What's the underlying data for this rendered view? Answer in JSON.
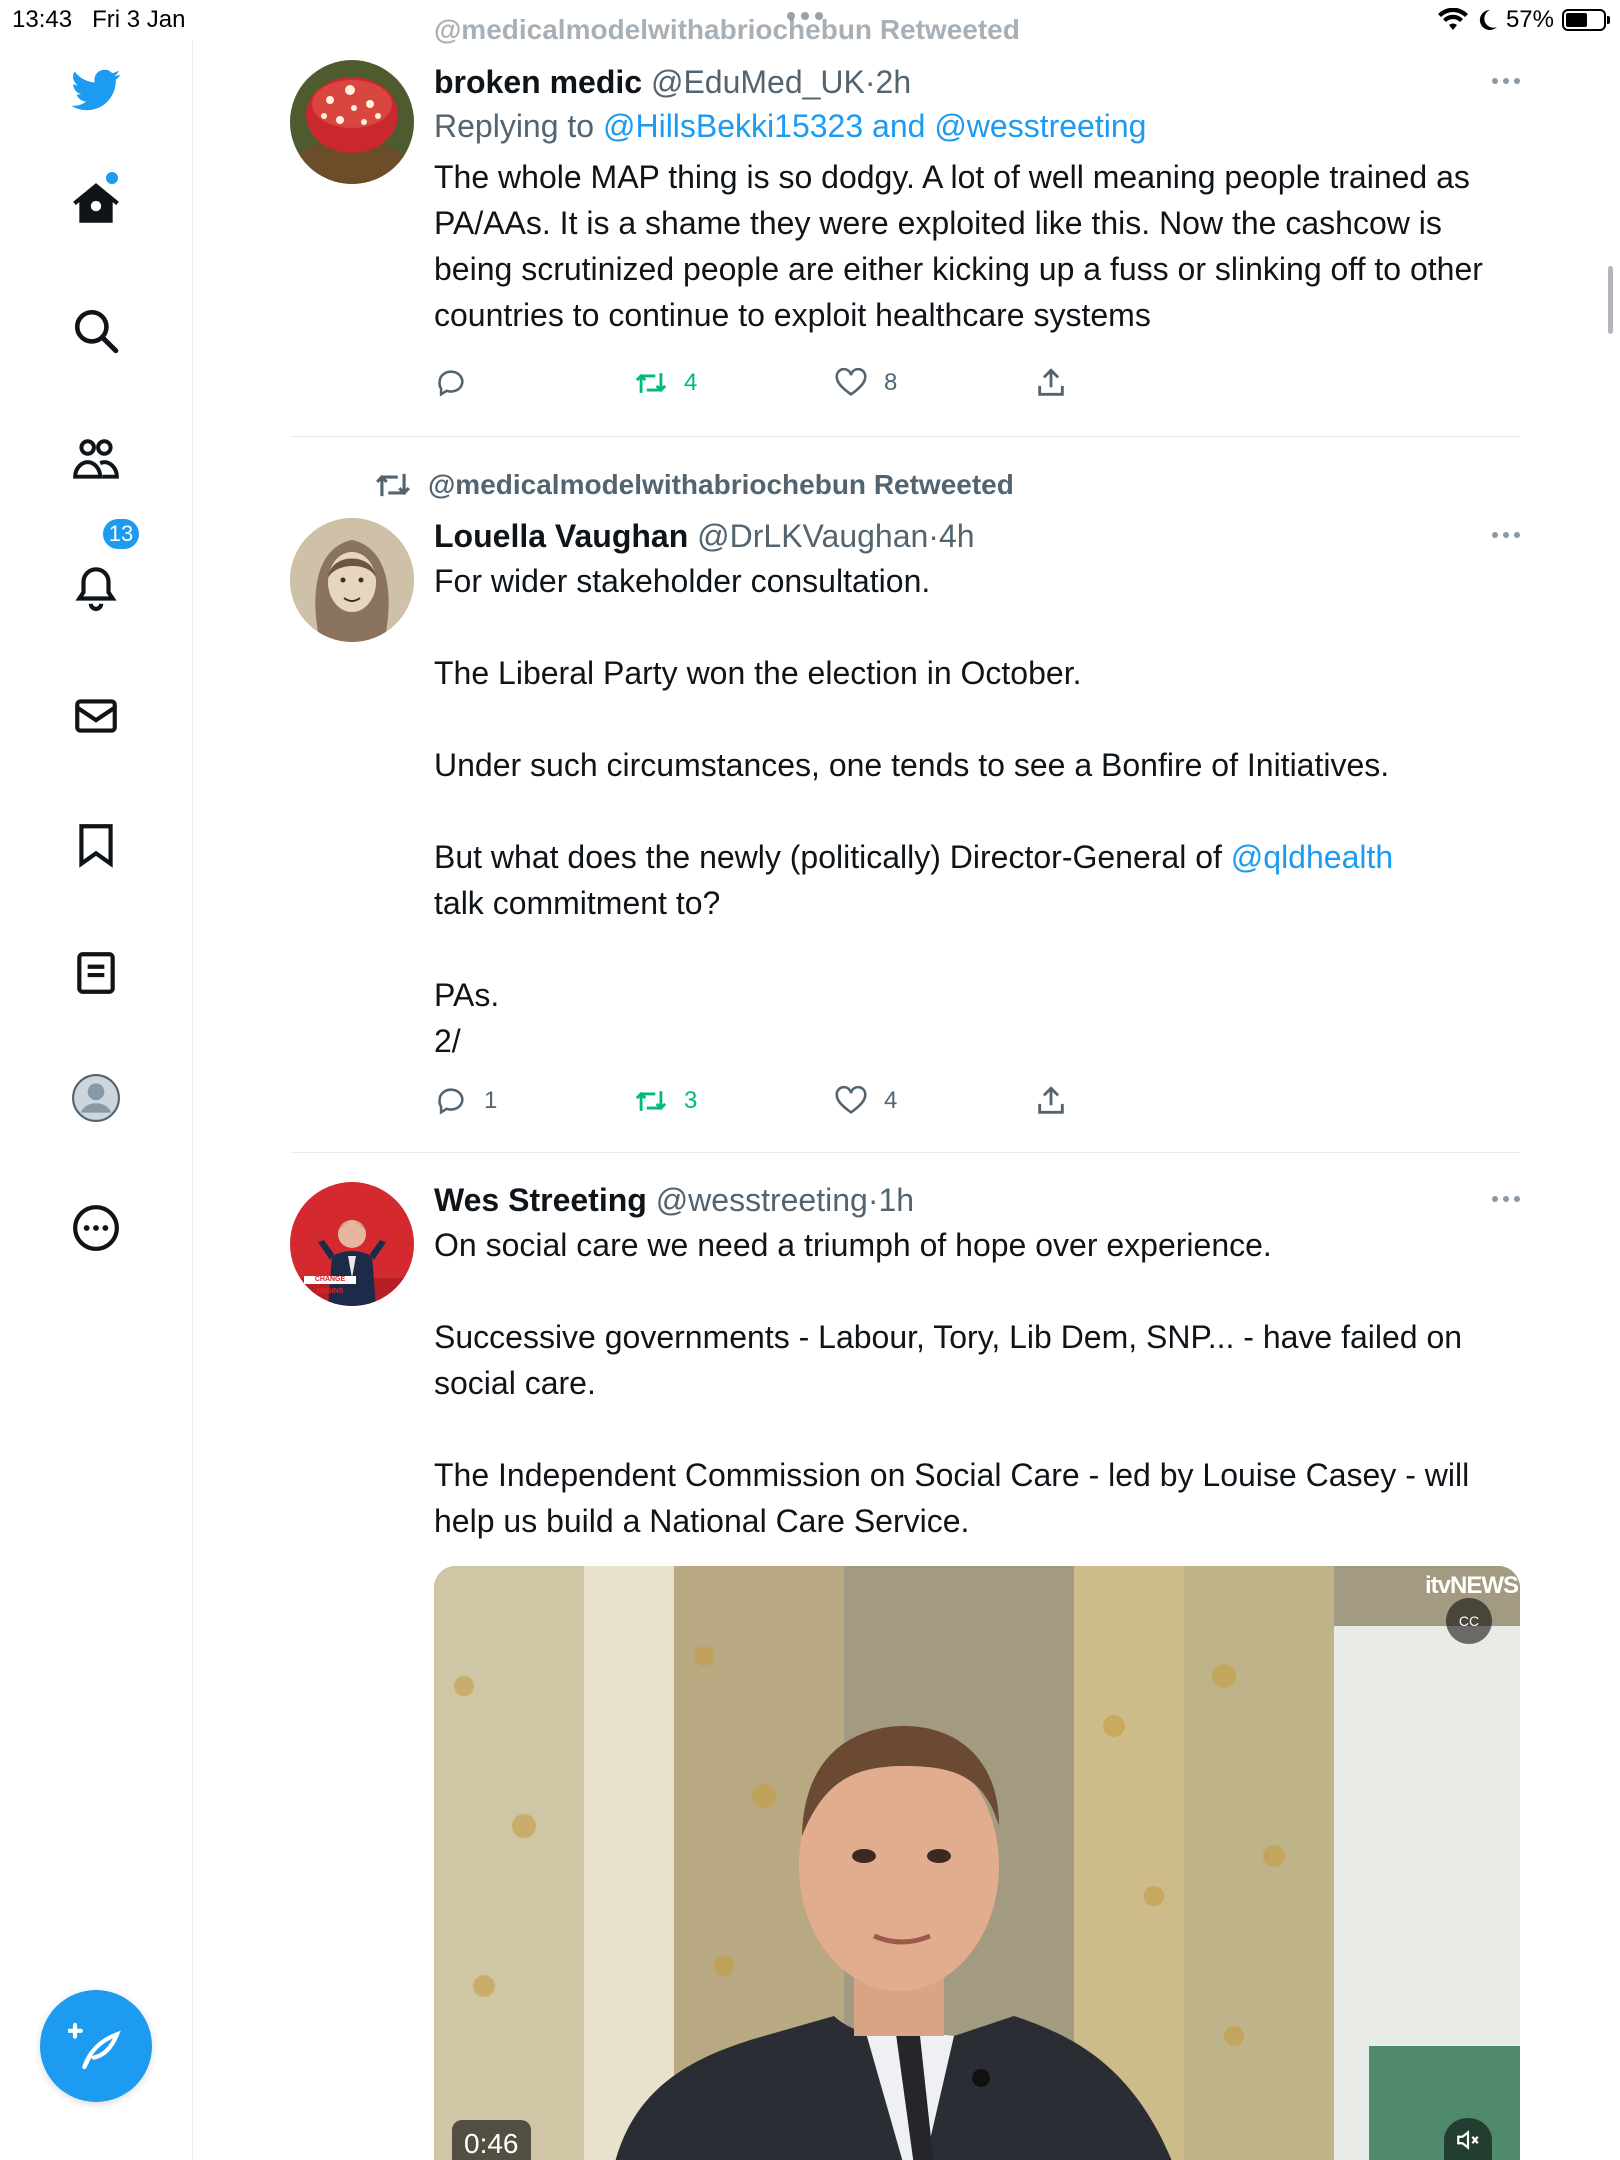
{
  "status_bar": {
    "time": "13:43",
    "date": "Fri 3 Jan",
    "battery": "57%"
  },
  "sidebar": {
    "notifications_count": "13",
    "items": [
      "twitter-logo",
      "home",
      "search",
      "communities",
      "notifications",
      "messages",
      "bookmarks",
      "lists",
      "profile",
      "more"
    ]
  },
  "prev_retweet_text": "@medicalmodelwithabriochebun Retweeted",
  "tweets": [
    {
      "name": "broken medic",
      "handle": "@EduMed_UK",
      "sep": "·",
      "time": "2h",
      "replying_prefix": "Replying to",
      "replying_to": "@HillsBekki15323 and @wesstreeting",
      "text": "The whole MAP thing is so dodgy. A lot of well meaning people trained as PA/AAs. It is a shame they were exploited like this. Now the cashcow is being scrutinized people are either kicking up a fuss or slinking off to other countries to continue to exploit healthcare systems",
      "replies": "",
      "retweets": "4",
      "likes": "8"
    },
    {
      "retweeted_by": "@medicalmodelwithabriochebun Retweeted",
      "name": "Louella Vaughan",
      "handle": "@DrLKVaughan",
      "sep": "·",
      "time": "4h",
      "paras": [
        "For wider stakeholder consultation.",
        "The Liberal Party won the election in October.",
        "Under such circumstances, one tends to see a Bonfire of Initiatives.",
        "But what does the newly (politically) Director-General of ",
        "PAs.\n2/"
      ],
      "mention": "@qldhealth",
      "para4_tail": "talk commitment to?",
      "replies": "1",
      "retweets": "3",
      "likes": "4"
    },
    {
      "name": "Wes Streeting",
      "handle": "@wesstreeting",
      "sep": "·",
      "time": "1h",
      "paras": [
        "On social care we need a triumph of hope over experience.",
        "Successive governments - Labour, Tory, Lib Dem, SNP... - have failed on social care.",
        "The Independent Commission on Social Care - led by Louise Casey - will help us build a National Care Service."
      ],
      "avatar_caption": "CHANGE BEGINS",
      "video": {
        "duration": "0:46",
        "channel": "itvNEWS",
        "cc": "CC"
      }
    }
  ],
  "colors": {
    "accent": "#1d9bf0",
    "retweet": "#00ba7c",
    "muted": "#536471"
  }
}
